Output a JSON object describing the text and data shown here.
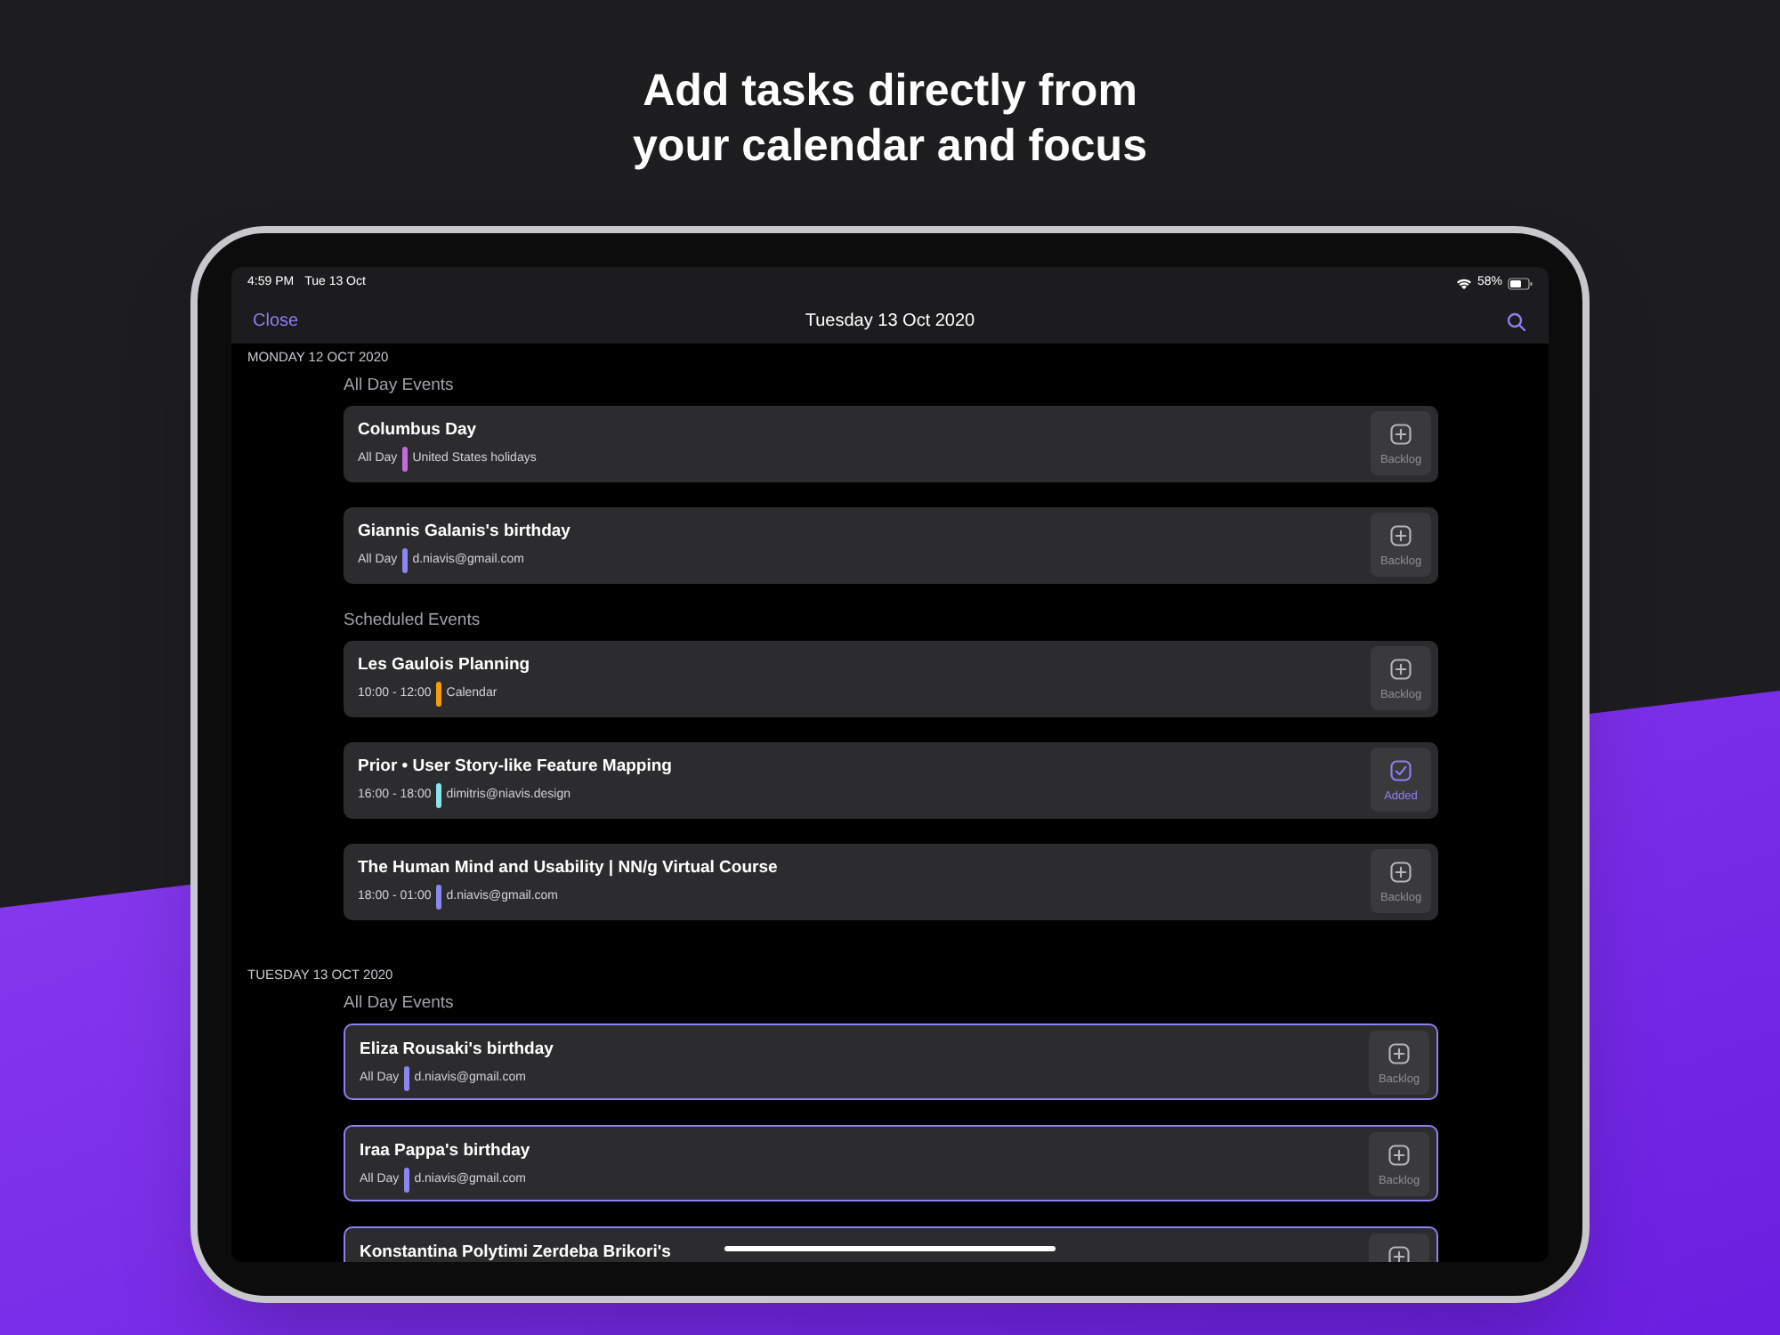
{
  "headline": [
    "Add tasks directly from",
    "your calendar and focus"
  ],
  "status_bar": {
    "time": "4:59 PM",
    "date": "Tue 13 Oct",
    "battery": "58%"
  },
  "nav": {
    "close": "Close",
    "title": "Tuesday 13 Oct 2020"
  },
  "days": [
    {
      "heading": "MONDAY 12 OCT 2020",
      "sections": [
        {
          "title": "All Day Events",
          "events": [
            {
              "title": "Columbus Day",
              "time": "All Day",
              "source": "United States holidays",
              "color": "#c36bdc",
              "highlighted": false,
              "action": {
                "kind": "backlog",
                "label": "Backlog"
              }
            },
            {
              "title": "Giannis Galanis's birthday",
              "time": "All Day",
              "source": "d.niavis@gmail.com",
              "color": "#8b86f0",
              "highlighted": false,
              "action": {
                "kind": "backlog",
                "label": "Backlog"
              }
            }
          ]
        },
        {
          "title": "Scheduled Events",
          "events": [
            {
              "title": "Les Gaulois Planning",
              "time": "10:00 - 12:00",
              "source": "Calendar",
              "color": "#f59e0b",
              "highlighted": false,
              "action": {
                "kind": "backlog",
                "label": "Backlog"
              }
            },
            {
              "title": "Prior • User Story-like Feature Mapping",
              "time": "16:00 - 18:00",
              "source": "dimitris@niavis.design",
              "color": "#8de3ec",
              "highlighted": false,
              "action": {
                "kind": "added",
                "label": "Added"
              }
            },
            {
              "title": "The Human Mind and Usability | NN/g Virtual Course",
              "time": "18:00 - 01:00",
              "source": "d.niavis@gmail.com",
              "color": "#8b86f0",
              "highlighted": false,
              "action": {
                "kind": "backlog",
                "label": "Backlog"
              }
            }
          ]
        }
      ]
    },
    {
      "heading": "TUESDAY 13 OCT 2020",
      "sections": [
        {
          "title": "All Day Events",
          "events": [
            {
              "title": "Eliza Rousaki's birthday",
              "time": "All Day",
              "source": "d.niavis@gmail.com",
              "color": "#8b86f0",
              "highlighted": true,
              "action": {
                "kind": "backlog",
                "label": "Backlog"
              }
            },
            {
              "title": "Iraa Pappa's birthday",
              "time": "All Day",
              "source": "d.niavis@gmail.com",
              "color": "#8b86f0",
              "highlighted": true,
              "action": {
                "kind": "backlog",
                "label": "Backlog"
              }
            },
            {
              "title": "Konstantina Polytimi Zerdeba Brikori's",
              "highlighted": true,
              "action": {
                "kind": "backlog"
              }
            }
          ]
        }
      ]
    }
  ]
}
